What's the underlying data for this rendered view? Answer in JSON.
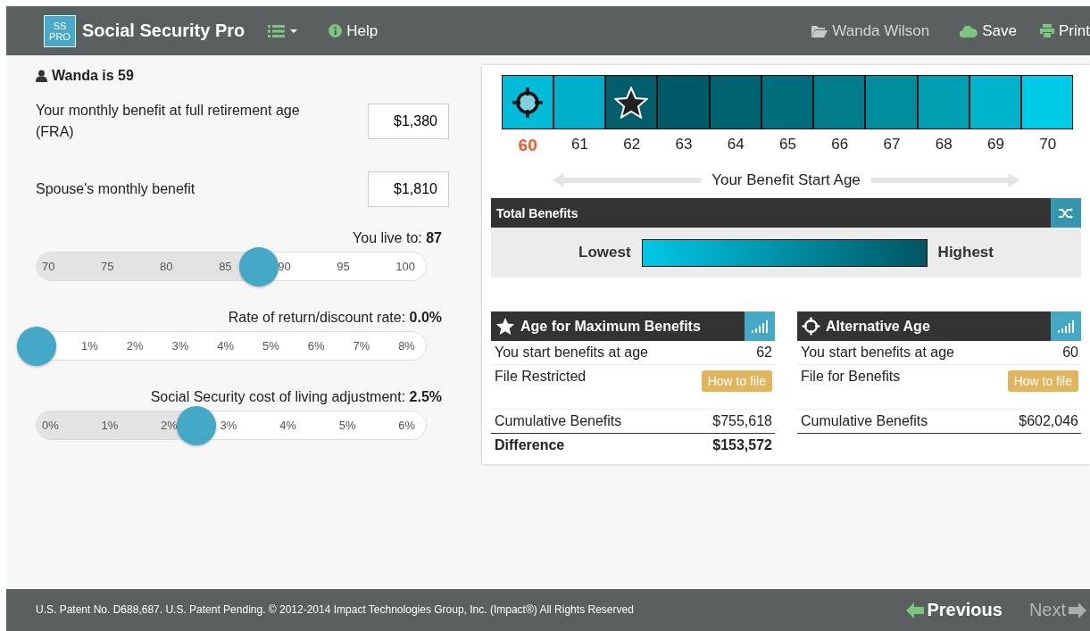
{
  "header": {
    "logo": [
      "SS",
      "PRO"
    ],
    "title": "Social Security Pro",
    "help": "Help",
    "user": "Wanda Wilson",
    "save": "Save",
    "print": "Print"
  },
  "person": {
    "heading": "Wanda is 59"
  },
  "fields": [
    {
      "label": "Your monthly benefit at full retirement age (FRA)",
      "value": "$1,380"
    },
    {
      "label": "Spouse's monthly benefit",
      "value": "$1,810"
    }
  ],
  "sliders": [
    {
      "label": "You live to: **87**",
      "level": 0.57,
      "ticks": [
        "70",
        "75",
        "80",
        "85",
        "90",
        "95",
        "100"
      ]
    },
    {
      "label": "Rate of return/discount rate: **0.0%**",
      "level": 0,
      "ticks": [
        "1%",
        "2%",
        "3%",
        "4%",
        "5%",
        "6%",
        "7%",
        "8%"
      ]
    },
    {
      "label": "Social Security cost of living adjustment: **2.5%**",
      "level": 0.41,
      "ticks": [
        "0%",
        "1%",
        "2%",
        "3%",
        "4%",
        "5%",
        "6%"
      ]
    }
  ],
  "ages": [
    {
      "age": "60",
      "color": "#00bcd8",
      "selected": true,
      "kind": "alternative"
    },
    {
      "age": "61",
      "color": "#00b0cb",
      "selected": false,
      "kind": "plain"
    },
    {
      "age": "62",
      "color": "#005d6a",
      "selected": false,
      "kind": "maximum"
    },
    {
      "age": "63",
      "color": "#005966",
      "selected": false,
      "kind": "plain"
    },
    {
      "age": "64",
      "color": "#00636f",
      "selected": false,
      "kind": "plain"
    },
    {
      "age": "65",
      "color": "#006e7c",
      "selected": false,
      "kind": "plain"
    },
    {
      "age": "66",
      "color": "#007c8b",
      "selected": false,
      "kind": "plain"
    },
    {
      "age": "67",
      "color": "#008d9d",
      "selected": false,
      "kind": "plain"
    },
    {
      "age": "68",
      "color": "#009fb2",
      "selected": false,
      "kind": "plain"
    },
    {
      "age": "69",
      "color": "#00b4cc",
      "selected": false,
      "kind": "plain"
    },
    {
      "age": "70",
      "color": "#00cbe6",
      "selected": false,
      "kind": "plain"
    }
  ],
  "axis_label": "Your Benefit Start Age",
  "total_benefits": {
    "title": "Total Benefits",
    "low": "Lowest",
    "high": "Highest"
  },
  "cards": [
    {
      "kind": "maximum",
      "title": "Age for Maximum Benefits",
      "rows": [
        {
          "kind": "value",
          "label": "You start benefits at age",
          "value": "62"
        },
        {
          "kind": "button",
          "label": "File Restricted",
          "button": "How to file"
        },
        {
          "kind": "value",
          "label": "Cumulative Benefits",
          "value": "$755,618"
        },
        {
          "kind": "total",
          "label": "Difference",
          "value": "$153,572"
        }
      ]
    },
    {
      "kind": "alternative",
      "title": "Alternative Age",
      "rows": [
        {
          "kind": "value",
          "label": "You start benefits at age",
          "value": "60"
        },
        {
          "kind": "button",
          "label": "File for Benefits",
          "button": "How to file"
        },
        {
          "kind": "value",
          "label": "Cumulative Benefits",
          "value": "$602,046"
        }
      ]
    }
  ],
  "footer": {
    "text": "U.S. Patent No. D688,687. U.S. Patent Pending. © 2012-2014 Impact Technologies Group, Inc. (Impact®) All Rights Reserved",
    "previous": {
      "label": "Previous",
      "disabled": false
    },
    "next": {
      "label": "Next",
      "disabled": true
    }
  }
}
